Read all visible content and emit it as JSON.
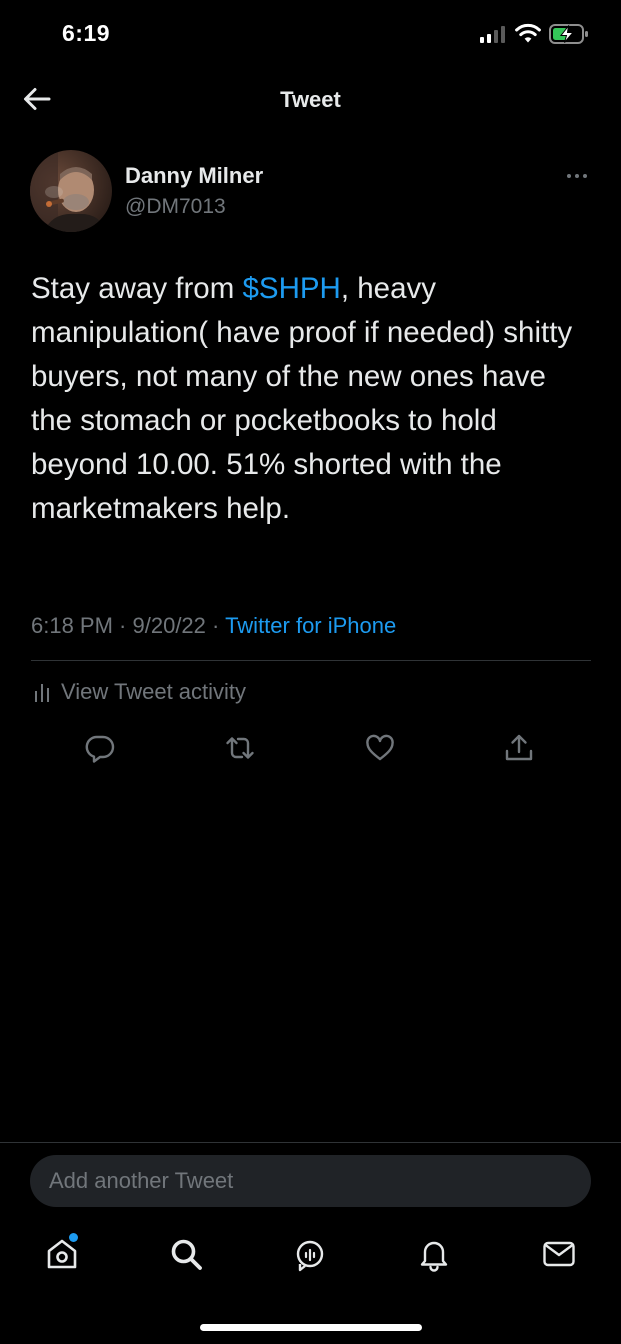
{
  "status_bar": {
    "time": "6:19"
  },
  "header": {
    "title": "Tweet"
  },
  "tweet": {
    "author_name": "Danny Milner",
    "author_handle": "@DM7013",
    "text_before": "Stay away from ",
    "cashtag": "$SHPH",
    "text_after": ", heavy manipulation( have proof if needed) shitty buyers, not many of the new ones have the stomach or pocketbooks to hold beyond 10.00. 51% shorted with the marketmakers help.",
    "time": "6:18 PM",
    "separator": " · ",
    "date": "9/20/22",
    "source": "Twitter for iPhone",
    "activity_label": "View Tweet activity"
  },
  "reply_box": {
    "placeholder": "Add another Tweet"
  },
  "icons": {
    "back": "arrow-left-icon",
    "more": "more-icon",
    "activity": "bar-chart-icon",
    "actions": [
      "reply-icon",
      "retweet-icon",
      "like-icon",
      "share-icon"
    ],
    "tabs": [
      "home-icon",
      "search-icon",
      "spaces-icon",
      "notifications-icon",
      "messages-icon"
    ]
  },
  "colors": {
    "background": "#000000",
    "accent": "#1d9bf0",
    "text_primary": "#e7e9ea",
    "text_secondary": "#71767b",
    "divider": "#2f3336",
    "input_bg": "#202327"
  }
}
